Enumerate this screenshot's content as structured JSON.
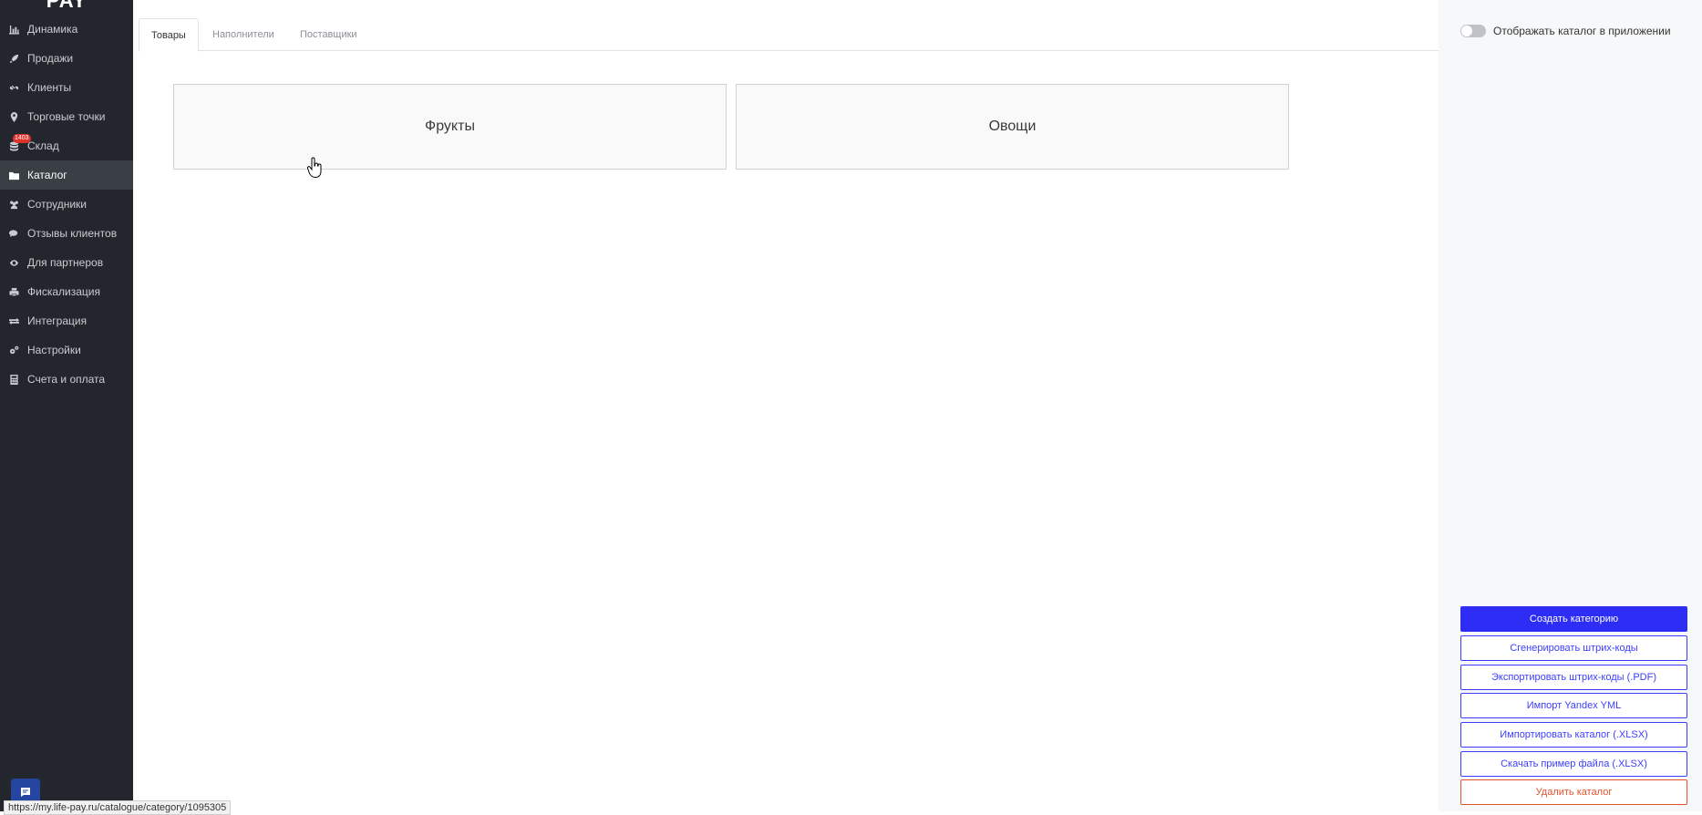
{
  "sidebar": {
    "logo": "PAY",
    "items": [
      {
        "label": "Динамика",
        "icon": "bar-chart-icon"
      },
      {
        "label": "Продажи",
        "icon": "rocket-icon"
      },
      {
        "label": "Клиенты",
        "icon": "link-icon"
      },
      {
        "label": "Торговые точки",
        "icon": "map-pin-icon"
      },
      {
        "label": "Склад",
        "icon": "database-icon",
        "badge": "1403"
      },
      {
        "label": "Каталог",
        "icon": "folder-icon",
        "active": true
      },
      {
        "label": "Сотрудники",
        "icon": "users-icon"
      },
      {
        "label": "Отзывы клиентов",
        "icon": "comments-icon"
      },
      {
        "label": "Для партнеров",
        "icon": "eye-icon"
      },
      {
        "label": "Фискализация",
        "icon": "printer-icon"
      },
      {
        "label": "Интеграция",
        "icon": "exchange-icon"
      },
      {
        "label": "Настройки",
        "icon": "cogs-icon"
      },
      {
        "label": "Счета и оплата",
        "icon": "calculator-icon"
      }
    ]
  },
  "tabs": [
    {
      "label": "Товары",
      "active": true
    },
    {
      "label": "Наполнители"
    },
    {
      "label": "Поставщики"
    }
  ],
  "categories": [
    {
      "label": "Фрукты"
    },
    {
      "label": "Овощи"
    }
  ],
  "panel": {
    "toggle_label": "Отображать каталог в приложении",
    "toggle_on": false,
    "buttons": {
      "create_category": "Создать категорию",
      "generate_barcodes": "Сгенерировать штрих-коды",
      "export_barcodes_pdf": "Экспортировать штрих-коды (.PDF)",
      "import_yandex_yml": "Импорт Yandex YML",
      "import_catalog_xlsx": "Импортировать каталог (.XLSX)",
      "download_sample_xlsx": "Скачать пример файла (.XLSX)",
      "delete_catalog": "Удалить каталог"
    }
  },
  "status_url": "https://my.life-pay.ru/catalogue/category/1095305",
  "colors": {
    "accent": "#2d2df5",
    "danger": "#e5532d",
    "sidebar_bg": "#23272d"
  }
}
